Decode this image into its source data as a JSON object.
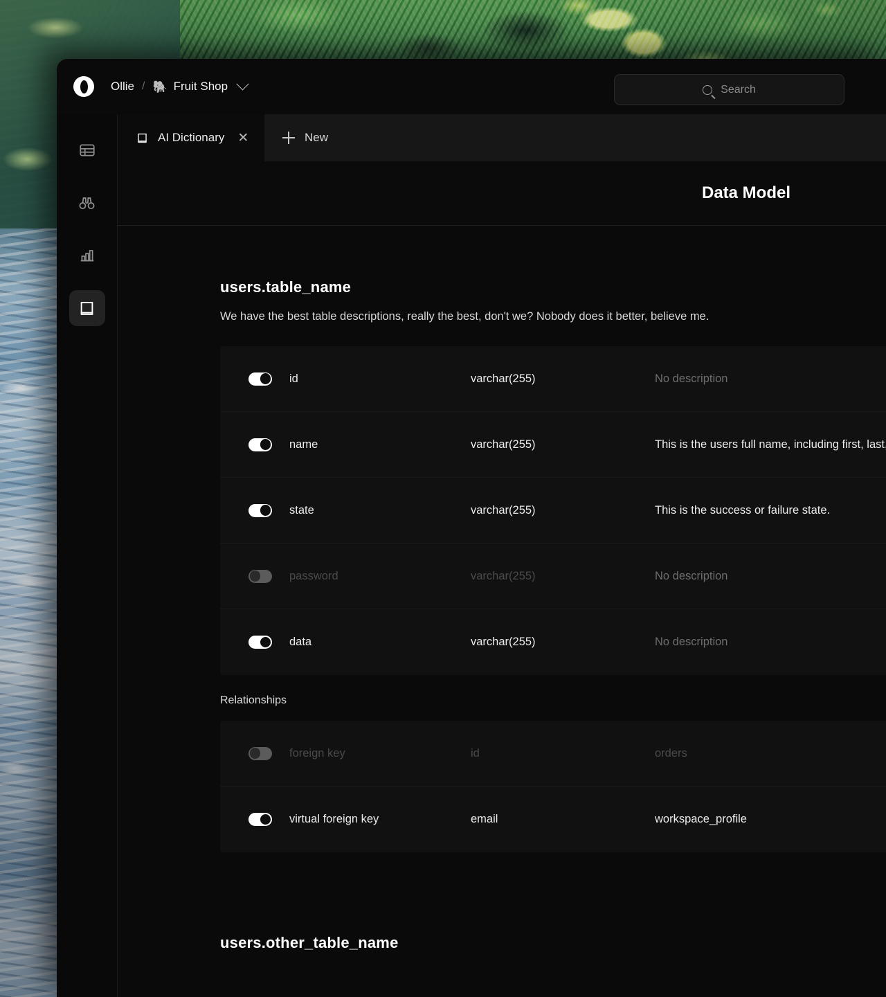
{
  "titlebar": {
    "logo_icon": "opera-o-logo",
    "user": "Ollie",
    "separator": "/",
    "workspace_emoji": "🐘",
    "workspace": "Fruit Shop",
    "chevron_icon": "chevron-down-icon"
  },
  "search": {
    "icon": "search-icon",
    "placeholder": "Search",
    "value": ""
  },
  "rail": {
    "items": [
      {
        "name": "tables",
        "icon": "table-icon",
        "active": false
      },
      {
        "name": "explore",
        "icon": "binoculars-icon",
        "active": false
      },
      {
        "name": "charts",
        "icon": "bar-chart-icon",
        "active": false
      },
      {
        "name": "dictionary",
        "icon": "book-icon",
        "active": true
      }
    ]
  },
  "tabs": {
    "open": [
      {
        "label": "AI Dictionary",
        "icon": "book-icon",
        "close_icon": "close-icon",
        "active": true
      }
    ],
    "new_label": "New",
    "new_icon": "plus-icon"
  },
  "page": {
    "title": "Data Model"
  },
  "sections": [
    {
      "table_name": "users.table_name",
      "description": "We have the best table descriptions, really the best, don't we? Nobody does it better, believe me.",
      "columns": [
        {
          "enabled": true,
          "field": "id",
          "type": "varchar(255)",
          "description": "No description",
          "has_description": false
        },
        {
          "enabled": true,
          "field": "name",
          "type": "varchar(255)",
          "description": "This is the users full name, including first, last,",
          "has_description": true
        },
        {
          "enabled": true,
          "field": "state",
          "type": "varchar(255)",
          "description": "This is the success or failure state.",
          "has_description": true
        },
        {
          "enabled": false,
          "field": "password",
          "type": "varchar(255)",
          "description": "No description",
          "has_description": false
        },
        {
          "enabled": true,
          "field": "data",
          "type": "varchar(255)",
          "description": "No description",
          "has_description": false
        }
      ],
      "relationships_label": "Relationships",
      "relationships": [
        {
          "enabled": false,
          "kind": "foreign key",
          "column": "id",
          "target": "orders"
        },
        {
          "enabled": true,
          "kind": "virtual foreign key",
          "column": "email",
          "target": "workspace_profile"
        }
      ]
    },
    {
      "table_name": "users.other_table_name"
    }
  ]
}
